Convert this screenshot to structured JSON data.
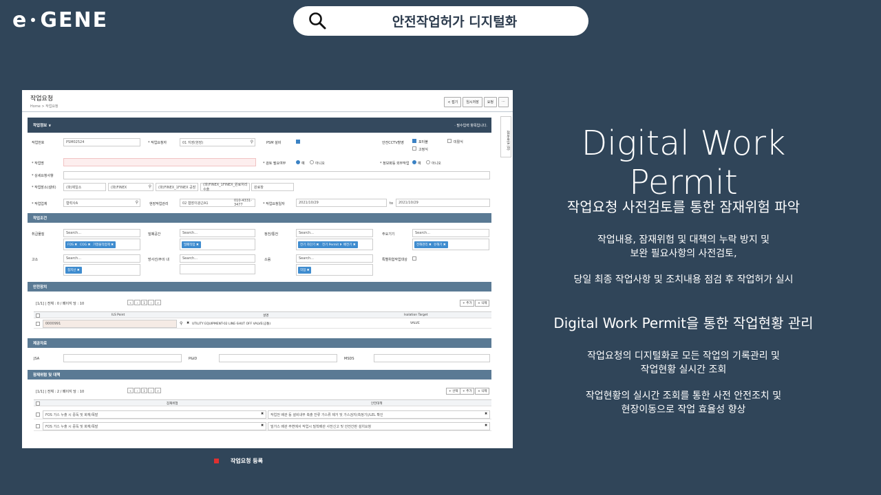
{
  "header": {
    "logo_left": "e",
    "logo_right": "GENE",
    "search_text": "안전작업허가  디지털화"
  },
  "screenshot": {
    "title": "작업요청",
    "breadcrumb": "Home > 작업요청",
    "buttons": [
      "< 접기",
      "임시저장",
      "요청",
      "⋯"
    ],
    "side_tab": "첨부파일 (0)",
    "section_work_info": "작업정보 ∨",
    "required_note": "· 필수입력 항목입니다.",
    "labels": {
      "work_no": "작업번호",
      "requester": "* 작업요청자",
      "psm": "PSM 설비",
      "cctv": "안전CCTV촬영",
      "work_name": "* 작업명",
      "review": "* 검토 필요여부",
      "info_work": "* 정보화등 외부작업",
      "detail": "* 상세요청사항",
      "location": "* 작업장소(설비)",
      "company": "* 작업업체",
      "site_manager": "현장작업관리",
      "period": "* 작업요청일자",
      "conditions": "작업조건",
      "handling": "취급물질",
      "space": "밀폐공간",
      "electric": "정전/통전",
      "tools": "주요기기",
      "height": "고소",
      "fire": "방사선/주의 내",
      "noise": "소음",
      "special": "특별위험작업대상",
      "safety": "안전장치",
      "ls_point": "ILS Point",
      "desc": "설명",
      "isolation": "Isolation Target",
      "docs": "제공자료",
      "jsa": "JSA",
      "pid": "P&ID",
      "msds": "MSDS",
      "risk": "잠재위험 및 대책",
      "hazard": "잠재위험",
      "measure": "안전대책"
    },
    "values": {
      "work_no": "PSM02524",
      "requester": "01 지영(현장)",
      "cctv_opt1": "포터블",
      "cctv_opt2": "고정식",
      "cctv_opt3": "미활식",
      "yes": "예",
      "no": "아니오",
      "loc1": "(파)제일소",
      "loc2": "(파)FINEX",
      "loc3": "(파)FINEX_1FINEX 공장",
      "loc4": "(파)FINEX_1FINEX_원료처리수출",
      "loc5": "원료창",
      "company": "협력사A",
      "manager": "02 협장이광근A1",
      "phone": "010-4331-3477",
      "date_from": "2021/10/29",
      "date_sep": "to",
      "date_to": "2021/10/29",
      "search": "Search...",
      "tag_fos": "FOS ✖",
      "tag_cog": "COG ✖",
      "tag_gas": "가열물작업제 ✖",
      "tag_space": "밀폐작업 ✖",
      "tag_e1": "전기 차단기 ✖",
      "tag_e2": "전기 Permit ✖",
      "tag_e3": "배전기 ✖",
      "tag_t1": "전해관리 ✖",
      "tag_t2": "유해기 ✖",
      "tag_h": "접지선 ✖",
      "tag_n": "작업 ✖",
      "pager1": "[1/1] | 전체 : 0 / 페이지 당 : 10",
      "pager2": "[1/1] | 전체 : 2 / 페이지 당 : 10",
      "add": "+ 추가",
      "del": "× 삭제",
      "select": "+ 선택",
      "ls_value": "0000991",
      "ls_desc": "UTILITY EQUIPMENT-02 LINE-SHUT OFF VALVE(공통)",
      "ls_iso": "VALVE",
      "h1": "FOS 가스 누출 시 중독 및 화재/폭발",
      "m1": "작업전 배관 등 설비내부 축출 잔류 가스류 제거 및 가스검지(측정기)/LEL 확인",
      "h2": "FOS 가스 누출 시 중독 및 화재/폭발",
      "m2": "밀가스 배관 주변에서 작업시 밀착배관 사전신고 및 안전간판 설치요청"
    }
  },
  "caption": "작업요청 등록",
  "right": {
    "title": "Digital Work Permit",
    "h1": "작업요청 사전검토를 통한 잠재위험 파악",
    "p1_l1": "작업내용, 잠재위험 및 대책의 누락 방지 및",
    "p1_l2": "보완 필요사항의 사전검토,",
    "p1_l3": "당일 최종 작업사항 및 조치내용 점검 후 작업허가 실시",
    "h2": "Digital Work Permit을 통한 작업현황 관리",
    "p2_l1": "작업요청의 디지털화로 모든 작업의 기록관리 및",
    "p2_l2": "작업현황 실시간 조회",
    "p2_l3": "작업현황의 실시간 조회를 통한 사전 안전조치 및",
    "p2_l4": "현장이동으로 작업 효율성 향상"
  },
  "colors": {
    "background": "#304559",
    "section": "#5a7a94",
    "accent": "#3f8ccf"
  }
}
